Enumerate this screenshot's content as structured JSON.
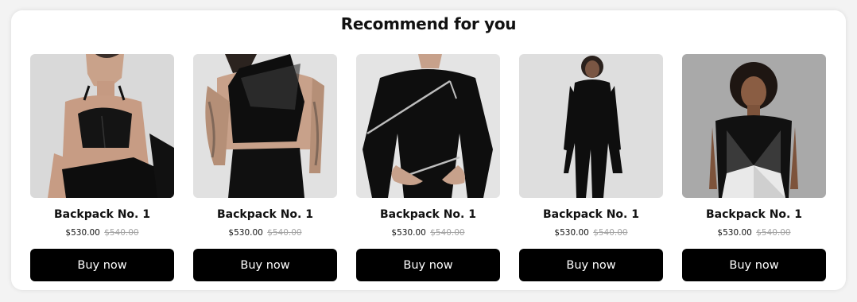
{
  "section": {
    "title": "Recommend for you"
  },
  "colors": {
    "button_bg": "#000000",
    "button_text": "#ffffff",
    "old_price": "#a3a3a3"
  },
  "products": [
    {
      "name": "Backpack No. 1",
      "price": "$530.00",
      "old_price": "$540.00",
      "cta": "Buy now",
      "image_icon": "model-leather-bustier-photo"
    },
    {
      "name": "Backpack No. 1",
      "price": "$530.00",
      "old_price": "$540.00",
      "cta": "Buy now",
      "image_icon": "model-mesh-crop-top-photo"
    },
    {
      "name": "Backpack No. 1",
      "price": "$530.00",
      "old_price": "$540.00",
      "cta": "Buy now",
      "image_icon": "model-zip-longsleeve-photo"
    },
    {
      "name": "Backpack No. 1",
      "price": "$530.00",
      "old_price": "$540.00",
      "cta": "Buy now",
      "image_icon": "model-asymmetric-tunic-photo"
    },
    {
      "name": "Backpack No. 1",
      "price": "$530.00",
      "old_price": "$540.00",
      "cta": "Buy now",
      "image_icon": "model-colorblock-top-photo"
    }
  ]
}
